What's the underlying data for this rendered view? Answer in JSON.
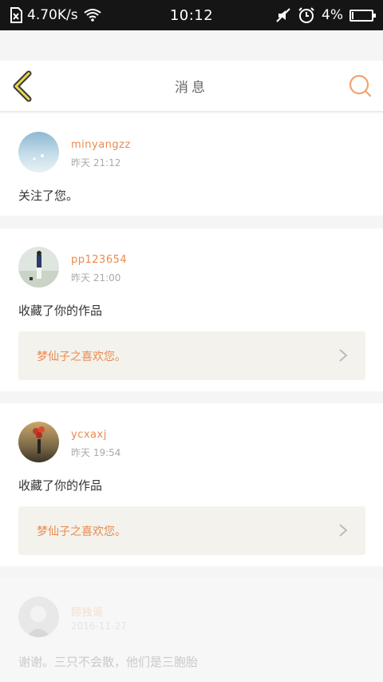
{
  "status_bar": {
    "network_speed": "4.70K/s",
    "time": "10:12",
    "battery": "4%"
  },
  "header": {
    "title": "消息"
  },
  "messages": [
    {
      "username": "minyangzz",
      "time": "昨天 21:12",
      "text": "关注了您。"
    },
    {
      "username": "pp123654",
      "time": "昨天 21:00",
      "text": "收藏了你的作品",
      "work": "梦仙子之喜欢您。"
    },
    {
      "username": "ycxaxj",
      "time": "昨天 19:54",
      "text": "收藏了你的作品",
      "work": "梦仙子之喜欢您。"
    },
    {
      "username": "顾独谣",
      "time": "2016-11-27",
      "text": "谢谢。三只不会散，他们是三胞胎"
    }
  ],
  "colors": {
    "accent": "#ea8a4f",
    "back_arrow": "#e8d94a",
    "status_bar_bg": "#151515",
    "work_box_bg": "#f3f2ec"
  },
  "icons": [
    "sim-off-icon",
    "wifi-icon",
    "mute-icon",
    "alarm-icon",
    "battery-icon",
    "back-arrow-icon",
    "search-icon",
    "chevron-right-icon"
  ]
}
